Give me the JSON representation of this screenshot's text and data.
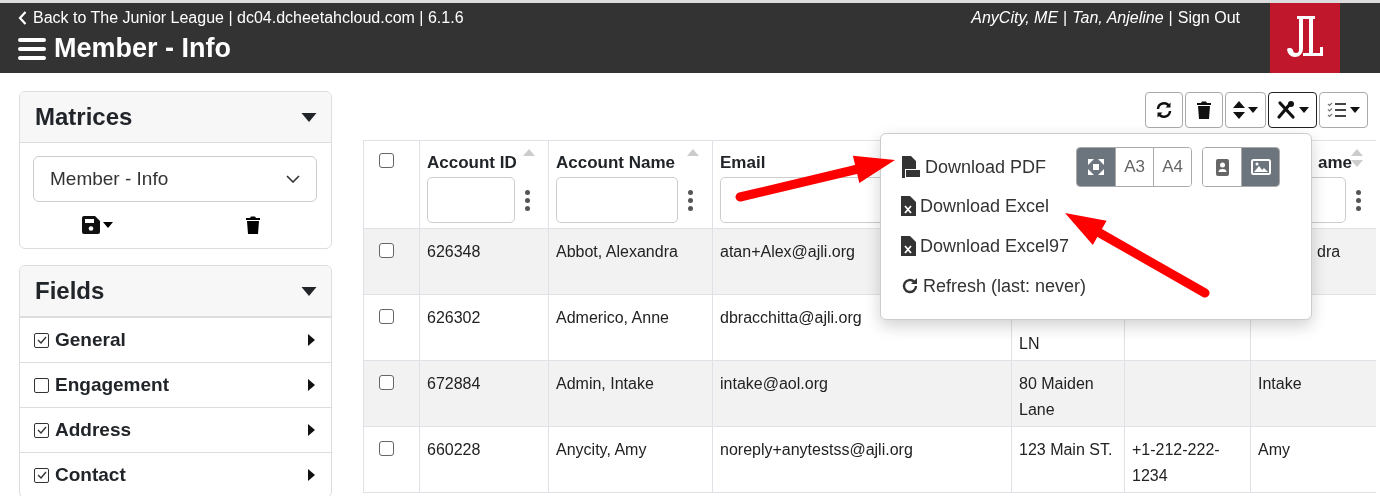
{
  "header": {
    "back_link": "Back to The Junior League | dc04.dcheetahcloud.com | 6.1.6",
    "title": "Member - Info",
    "user_links": [
      {
        "kind": "italic",
        "text": "AnyCity, ME"
      },
      {
        "kind": "separator",
        "text": "|"
      },
      {
        "kind": "italic",
        "text": "Tan, Anjeline"
      },
      {
        "kind": "separator",
        "text": "|"
      },
      {
        "kind": "link",
        "text": "Sign Out"
      }
    ]
  },
  "sidebar": {
    "matrices": {
      "title": "Matrices",
      "select_value": "Member - Info"
    },
    "fields": {
      "title": "Fields",
      "items": [
        {
          "label": "General",
          "checked": true
        },
        {
          "label": "Engagement",
          "checked": false
        },
        {
          "label": "Address",
          "checked": true
        },
        {
          "label": "Contact",
          "checked": true
        }
      ]
    }
  },
  "toolbar": [
    {
      "kind": "refresh",
      "expanded": false
    },
    {
      "kind": "delete",
      "expanded": false
    },
    {
      "kind": "sort",
      "expanded": false
    },
    {
      "kind": "tools",
      "expanded": true
    },
    {
      "kind": "columns",
      "expanded": false
    }
  ],
  "table": {
    "select_all_checked": false,
    "columns": [
      "Account ID",
      "Account Name",
      "Email",
      null,
      null,
      "ame"
    ],
    "rows": [
      {
        "checked": false,
        "cells": [
          "626348",
          "Abbot, Alexandra",
          "atan+Alex@ajli.org",
          null,
          null,
          "dra"
        ]
      },
      {
        "checked": false,
        "cells": [
          "626302",
          "Admerico, Anne",
          "dbracchitta@ajli.org",
          "LN",
          null,
          null
        ]
      },
      {
        "checked": false,
        "cells": [
          "672884",
          "Admin, Intake",
          "intake@aol.org",
          "80 Maiden Lane",
          null,
          "Intake"
        ]
      },
      {
        "checked": false,
        "cells": [
          "660228",
          "Anycity, Amy",
          "noreply+anytestss@ajli.org",
          "123 Main ST.",
          "+1-212-222-1234",
          "Amy"
        ]
      }
    ]
  },
  "export_menu": {
    "items": [
      {
        "kind": "pdf",
        "label": "Download PDF"
      },
      {
        "kind": "excel",
        "label": "Download Excel"
      },
      {
        "kind": "excel",
        "label": "Download Excel97"
      },
      {
        "kind": "refresh",
        "label": "Refresh (last: never)"
      }
    ],
    "page_sizes": [
      {
        "kind": "fit",
        "selected": true
      },
      {
        "kind": "size",
        "label": "A3",
        "selected": false
      },
      {
        "kind": "size",
        "label": "A4",
        "selected": false
      }
    ],
    "orientations": [
      {
        "kind": "portrait",
        "selected": false
      },
      {
        "kind": "landscape",
        "selected": true
      }
    ]
  }
}
